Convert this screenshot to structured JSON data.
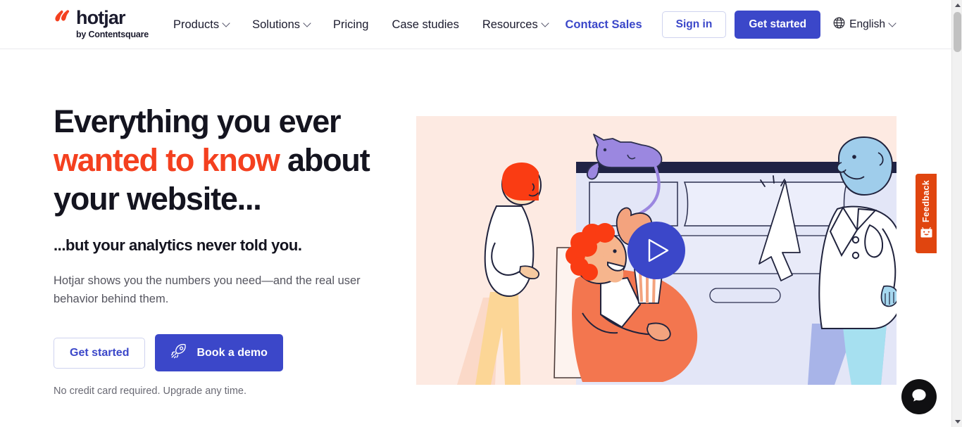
{
  "brand": {
    "logo_word": "hotjar",
    "logo_tagline": "by Contentsquare",
    "accent_orange": "#f4401f",
    "accent_blue": "#3b47c9",
    "hero_bg": "#fdeae2",
    "feedback_red": "#e0450f"
  },
  "header": {
    "nav": [
      {
        "label": "Products",
        "has_chevron": true
      },
      {
        "label": "Solutions",
        "has_chevron": true
      },
      {
        "label": "Pricing",
        "has_chevron": false
      },
      {
        "label": "Case studies",
        "has_chevron": false
      },
      {
        "label": "Resources",
        "has_chevron": true
      }
    ],
    "contact_sales": "Contact Sales",
    "sign_in": "Sign in",
    "get_started": "Get started",
    "language": "English"
  },
  "hero": {
    "headline_line1": "Everything you ever",
    "headline_accent": "wanted to know",
    "headline_line2_rest": " about",
    "headline_line3": "your website...",
    "subheadline": "...but your analytics never told you.",
    "body": "Hotjar shows you the numbers you need—and the real user behavior behind them.",
    "cta_primary": "Get started",
    "cta_secondary": "Book a demo",
    "fineprint": "No credit card required. Upgrade any time."
  },
  "widgets": {
    "feedback_label": "Feedback",
    "chat_label": "Chat"
  }
}
